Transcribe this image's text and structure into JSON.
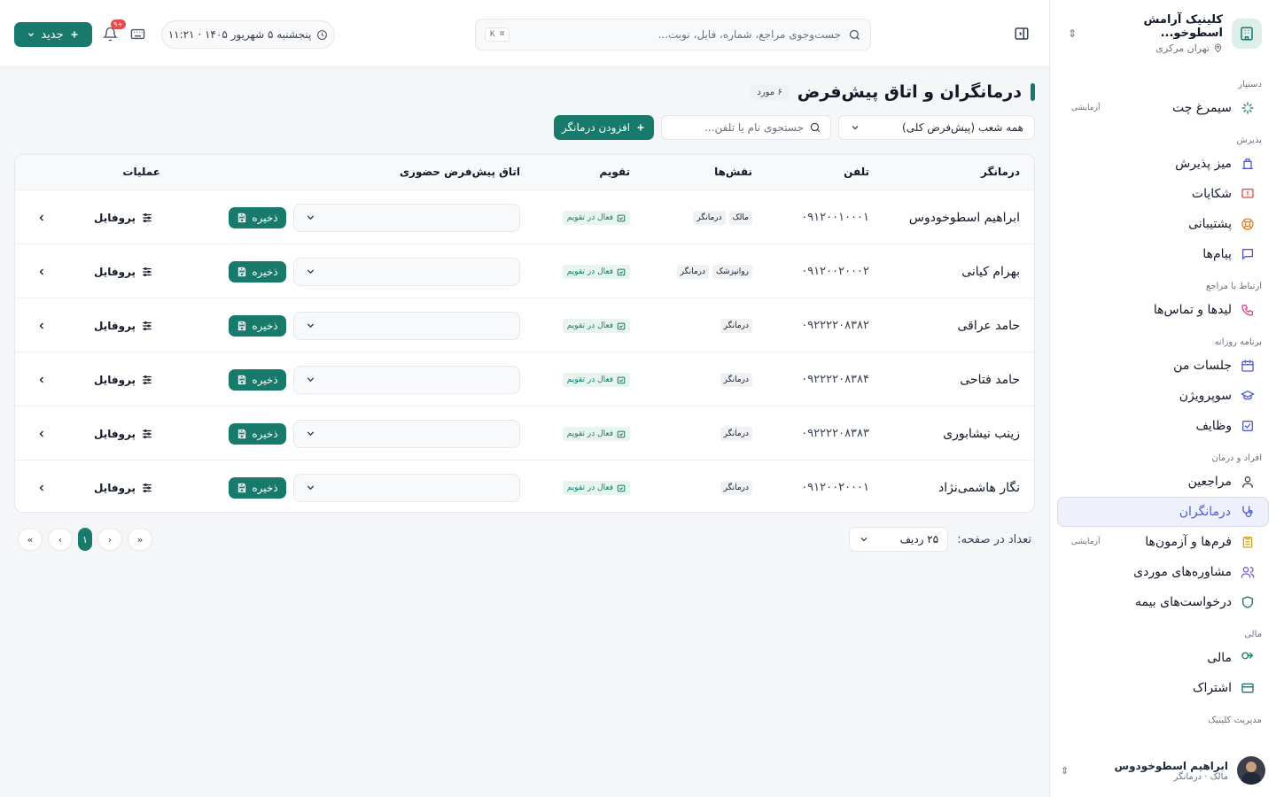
{
  "clinic": {
    "name": "کلینیک آرامش اسطوخو...",
    "location": "تهران مرکزی"
  },
  "nav": [
    {
      "section": "دستیار",
      "items": [
        {
          "key": "simorgh",
          "label": "سیمرغ چت",
          "tag": "آزمایشی",
          "icon": "sparkle-icon"
        }
      ]
    },
    {
      "section": "پذیرش",
      "items": [
        {
          "key": "desk",
          "label": "میز پذیرش",
          "icon": "desk-icon"
        },
        {
          "key": "complaints",
          "label": "شکایات",
          "icon": "alert-message-icon"
        },
        {
          "key": "support",
          "label": "پشتیبانی",
          "icon": "lifebuoy-icon"
        },
        {
          "key": "messages",
          "label": "پیام‌ها",
          "icon": "message-icon"
        }
      ]
    },
    {
      "section": "ارتباط با مراجع",
      "items": [
        {
          "key": "leads",
          "label": "لیدها و تماس‌ها",
          "icon": "phone-icon"
        }
      ]
    },
    {
      "section": "برنامه روزانه",
      "items": [
        {
          "key": "sessions",
          "label": "جلسات من",
          "icon": "calendar-icon"
        },
        {
          "key": "supervision",
          "label": "سوپرویژن",
          "icon": "graduation-cap-icon"
        },
        {
          "key": "tasks",
          "label": "وظایف",
          "icon": "checkbox-icon"
        }
      ]
    },
    {
      "section": "افراد و درمان",
      "items": [
        {
          "key": "clients",
          "label": "مراجعین",
          "icon": "user-icon"
        },
        {
          "key": "therapists",
          "label": "درمانگران",
          "icon": "stethoscope-icon",
          "active": true
        },
        {
          "key": "forms",
          "label": "فرم‌ها و آزمون‌ها",
          "tag": "آزمایشی",
          "icon": "clipboard-icon"
        },
        {
          "key": "case",
          "label": "مشاوره‌های موردی",
          "icon": "users-icon"
        },
        {
          "key": "insurance",
          "label": "درخواست‌های بیمه",
          "icon": "shield-icon"
        }
      ]
    },
    {
      "section": "مالی",
      "items": [
        {
          "key": "finance",
          "label": "مالی",
          "icon": "wallet-icon"
        },
        {
          "key": "subscription",
          "label": "اشتراک",
          "icon": "credit-card-icon"
        }
      ]
    },
    {
      "section": "مدیریت کلینیک",
      "items": []
    }
  ],
  "user": {
    "name": "ابراهیم اسطوخودوس",
    "role": "مالک · درمانگر"
  },
  "topbar": {
    "new_label": "جدید",
    "notifications_badge": "۹+",
    "datetime": "پنجشنبه ۵ شهریور ۱۴۰۵ · ۱۱:۲۱",
    "search_placeholder": "جست‌وجوی مراجع، شماره، فایل، نوبت...",
    "shortcut": "⌘ K"
  },
  "page": {
    "title": "درمانگران و اتاق پیش‌فرض",
    "count": "۶ مورد",
    "branch_select": "همه شعب (پیش‌فرض کلی)",
    "name_search_placeholder": "جستجوی نام یا تلفن...",
    "add_label": "افزودن درمانگر"
  },
  "table": {
    "headers": {
      "name": "درمانگر",
      "phone": "تلفن",
      "roles": "نقش‌ها",
      "calendar": "تقویم",
      "room": "اتاق پیش‌فرض حضوری",
      "actions": "عملیات"
    },
    "save_label": "ذخیره",
    "profile_label": "پروفایل",
    "rows": [
      {
        "name": "ابراهیم اسطوخودوس",
        "phone": "۰۹۱۲۰۰۱۰۰۰۱",
        "roles": [
          "مالک",
          "درمانگر"
        ],
        "calendar": "فعال در تقویم"
      },
      {
        "name": "بهرام کیانی",
        "phone": "۰۹۱۲۰۰۲۰۰۰۲",
        "roles": [
          "روانپزشک",
          "درمانگر"
        ],
        "calendar": "فعال در تقویم"
      },
      {
        "name": "حامد عراقی",
        "phone": "۰۹۲۲۲۲۰۸۳۸۲",
        "roles": [
          "درمانگر"
        ],
        "calendar": "فعال در تقویم"
      },
      {
        "name": "حامد فتاحی",
        "phone": "۰۹۲۲۲۲۰۸۳۸۴",
        "roles": [
          "درمانگر"
        ],
        "calendar": "فعال در تقویم"
      },
      {
        "name": "زینب نیشابوری",
        "phone": "۰۹۲۲۲۲۰۸۳۸۳",
        "roles": [
          "درمانگر"
        ],
        "calendar": "فعال در تقویم"
      },
      {
        "name": "نگار هاشمی‌نژاد",
        "phone": "۰۹۱۲۰۰۲۰۰۰۱",
        "roles": [
          "درمانگر"
        ],
        "calendar": "فعال در تقویم"
      }
    ]
  },
  "pagination": {
    "rows_label": "تعداد در صفحه:",
    "rows_value": "۲۵ ردیف",
    "current_page": "۱"
  },
  "colors": {
    "primary": "#177a6b",
    "active_nav": "#4f5bd5",
    "badge": "#e24c4c"
  }
}
